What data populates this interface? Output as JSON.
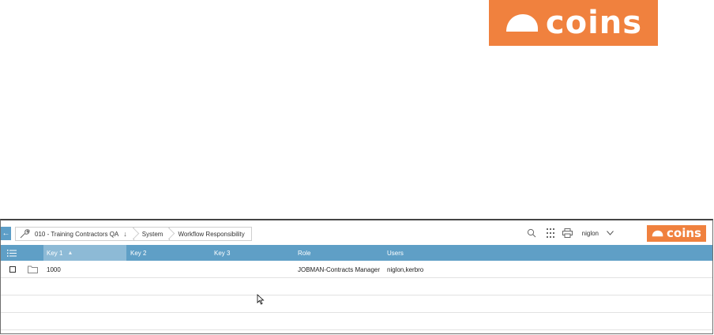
{
  "brand": {
    "logo_text": "coins",
    "color": "#f0813e"
  },
  "toolbar": {
    "back_icon": "left-arrow-icon",
    "breadcrumbs": [
      {
        "label": "010 - Training Contractors QA",
        "icon": "wrench-icon",
        "suffix": "↓"
      },
      {
        "label": "System"
      },
      {
        "label": "Workflow Responsibility"
      }
    ],
    "icons": [
      "search-icon",
      "apps-grid-icon",
      "print-icon"
    ],
    "user": "niglon"
  },
  "grid": {
    "accent": "#5f9fc6",
    "columns": [
      "Key 1",
      "Key 2",
      "Key 3",
      "Role",
      "Users"
    ],
    "sorted_column": "Key 1",
    "rows": [
      {
        "key1": "1000",
        "key2": "",
        "key3": "",
        "role": "JOBMAN-Contracts Manager",
        "users": "niglon,kerbro"
      }
    ]
  }
}
